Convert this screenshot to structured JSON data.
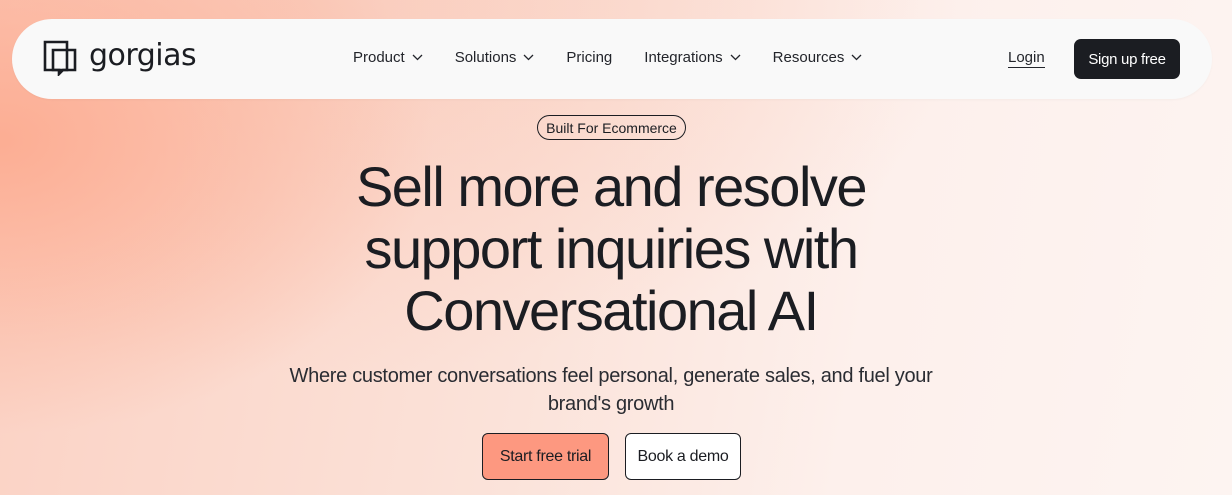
{
  "nav": {
    "logo_text": "gorgias",
    "logo_icon": "gorgias-logo-icon",
    "menu": [
      {
        "label": "Product",
        "has_dropdown": true
      },
      {
        "label": "Solutions",
        "has_dropdown": true
      },
      {
        "label": "Pricing",
        "has_dropdown": false
      },
      {
        "label": "Integrations",
        "has_dropdown": true
      },
      {
        "label": "Resources",
        "has_dropdown": true
      }
    ],
    "login_label": "Login",
    "signup_label": "Sign up free"
  },
  "hero": {
    "badge": "Built For Ecommerce",
    "headline_lines": [
      "Sell more and resolve",
      "support inquiries with",
      "Conversational AI"
    ],
    "subtitle_lines": [
      "Where customer conversations feel personal, generate sales, and fuel your",
      "brand's growth"
    ],
    "primary_cta": "Start free trial",
    "secondary_cta": "Book a demo"
  },
  "colors": {
    "dark": "#1b1d22",
    "accent": "#fd9880",
    "nav_bg": "#f9f9f9"
  }
}
